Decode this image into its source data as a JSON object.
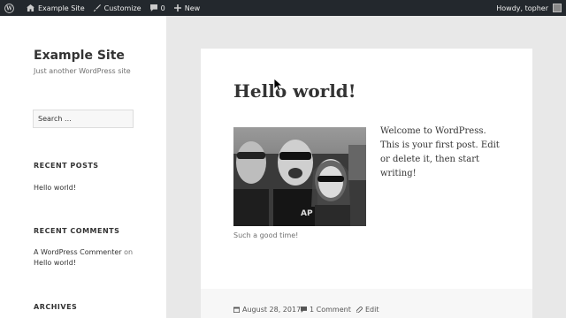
{
  "adminbar": {
    "site_name": "Example Site",
    "customize": "Customize",
    "comments_count": "0",
    "new_label": "New",
    "howdy": "Howdy, topher"
  },
  "sidebar": {
    "site_title": "Example Site",
    "site_desc": "Just another WordPress site",
    "search_placeholder": "Search ...",
    "recent_posts_title": "RECENT POSTS",
    "recent_post": "Hello world!",
    "recent_comments_title": "RECENT COMMENTS",
    "comment_author": "A WordPress Commenter",
    "comment_on": "on",
    "comment_post": "Hello world!",
    "archives_title": "ARCHIVES"
  },
  "post": {
    "title": "Hello world!",
    "body": "Welcome to WordPress. This is your first post. Edit or delete it, then start writing!",
    "caption": "Such a good time!",
    "date": "August 28, 2017",
    "comments": "1 Comment",
    "edit": "Edit"
  },
  "colors": {
    "admin_bar_bg": "#23282d",
    "page_bg": "#e8e8e8",
    "card_bg": "#ffffff"
  }
}
